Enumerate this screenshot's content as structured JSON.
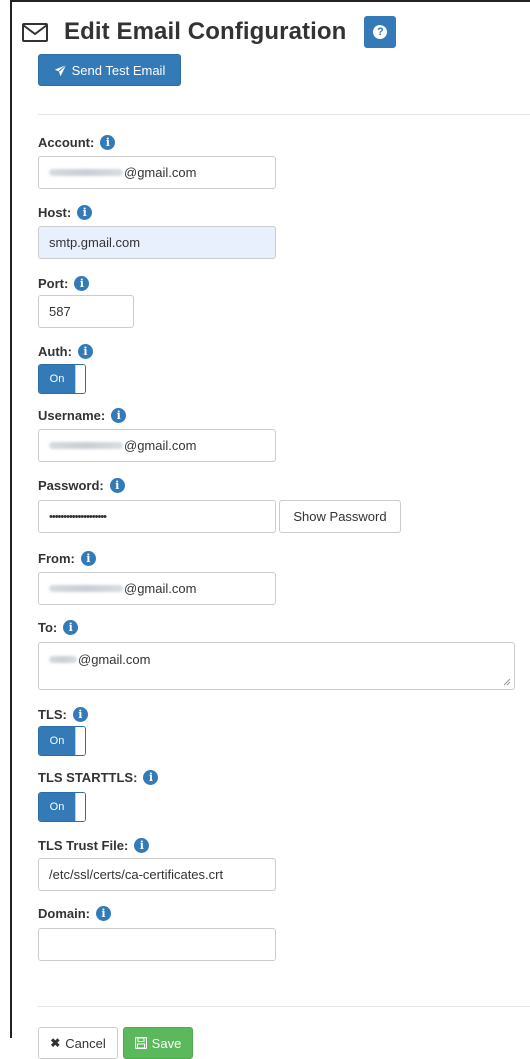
{
  "header": {
    "title": "Edit Email Configuration",
    "icon": "envelope-icon",
    "help_icon": "question-icon"
  },
  "actions": {
    "send_test_label": "Send Test Email",
    "send_test_icon": "paper-plane-icon"
  },
  "fields": {
    "account": {
      "label": "Account:",
      "value_suffix": "@gmail.com"
    },
    "host": {
      "label": "Host:",
      "value": "smtp.gmail.com"
    },
    "port": {
      "label": "Port:",
      "value": "587"
    },
    "auth": {
      "label": "Auth:",
      "toggle": "On"
    },
    "username": {
      "label": "Username:",
      "value_suffix": "@gmail.com"
    },
    "password": {
      "label": "Password:",
      "masked": "••••••••••••••••••••",
      "show_label": "Show Password"
    },
    "from": {
      "label": "From:",
      "value_suffix": "@gmail.com"
    },
    "to": {
      "label": "To:",
      "value_suffix": "@gmail.com"
    },
    "tls": {
      "label": "TLS:",
      "toggle": "On"
    },
    "tls_starttls": {
      "label": "TLS STARTTLS:",
      "toggle": "On"
    },
    "tls_trust_file": {
      "label": "TLS Trust File:",
      "value": "/etc/ssl/certs/ca-certificates.crt"
    },
    "domain": {
      "label": "Domain:",
      "value": ""
    }
  },
  "footer": {
    "cancel_label": "Cancel",
    "save_label": "Save"
  },
  "colors": {
    "primary": "#337ab7",
    "success": "#5cb85c",
    "autofill": "#e8f0fe"
  }
}
